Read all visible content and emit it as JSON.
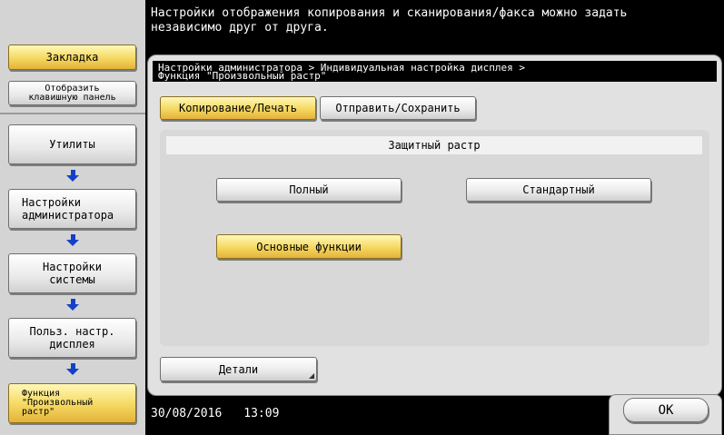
{
  "message": "Настройки отображения копирования и сканирования/факса можно задать\nнезависимо друг от друга.",
  "sidebar": {
    "bookmark": "Закладка",
    "show_keypad": "Отобразить\nклавишную панель",
    "steps": [
      "Утилиты",
      "Настройки\nадминистратора",
      "Настройки\nсистемы",
      "Польз. настр.\nдисплея",
      "Функция\n\"Произвольный\nрастр\""
    ]
  },
  "breadcrumb": "Настройки администратора > Индивидуальная настройка дисплея >\nФункция \"Произвольный растр\"",
  "tabs": {
    "copy_print": "Копирование/Печать",
    "send_save": "Отправить/Сохранить",
    "active": "copy_print"
  },
  "section": {
    "title": "Защитный растр",
    "options": {
      "full": "Полный",
      "standard": "Стандартный",
      "basic": "Основные функции"
    },
    "selected": "basic"
  },
  "details_label": "Детали",
  "status": {
    "date": "30/08/2016",
    "time": "13:09"
  },
  "ok_label": "OK",
  "colors": {
    "selected": "#f5d860",
    "arrow": "#1440c8",
    "background": "#000000",
    "panel": "#e1e1e1"
  }
}
